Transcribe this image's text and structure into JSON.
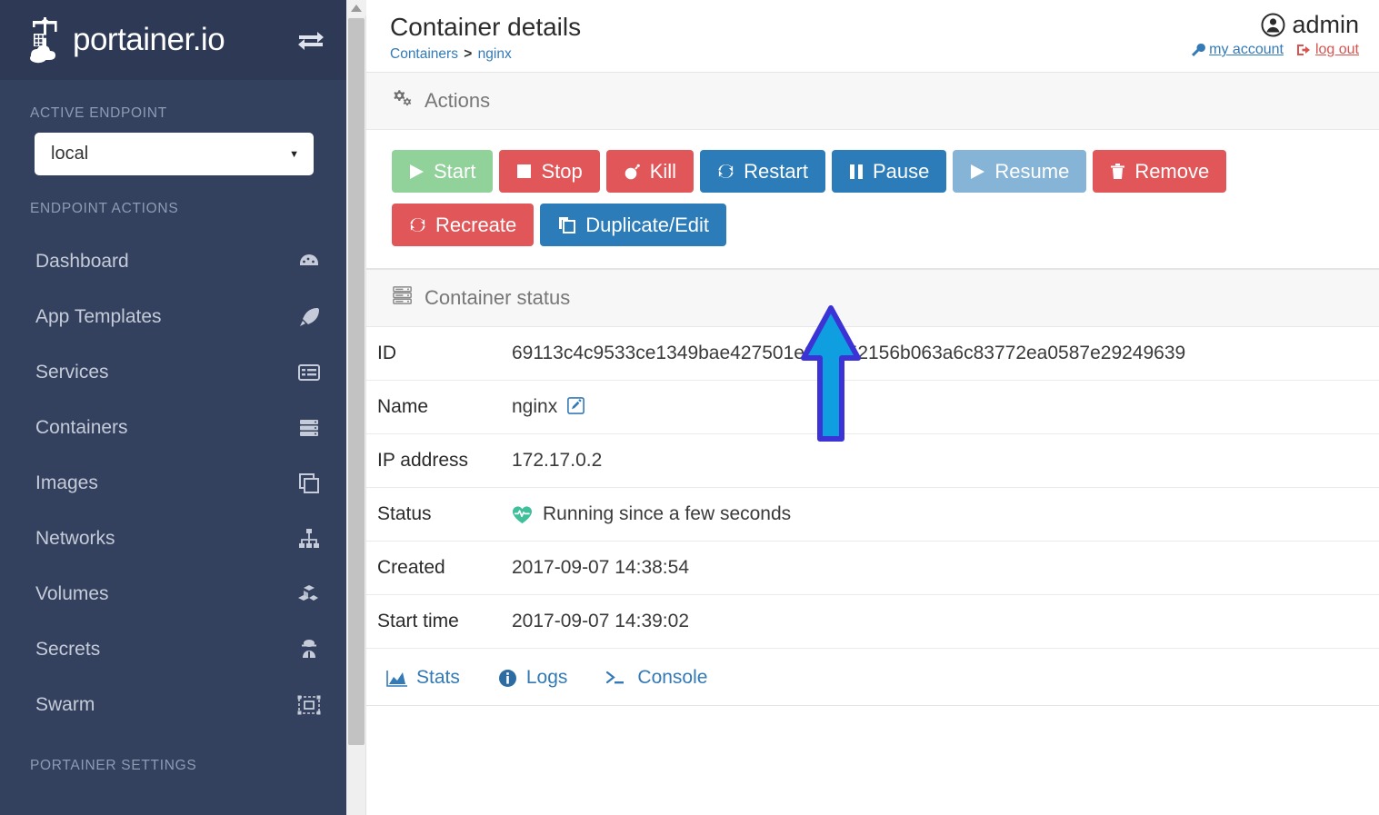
{
  "sidebar": {
    "brand": "portainer.io",
    "toggle_icon": "exchange-arrows-icon",
    "sections": {
      "active_endpoint": "ACTIVE ENDPOINT",
      "endpoint_actions": "ENDPOINT ACTIONS",
      "portainer_settings": "PORTAINER SETTINGS"
    },
    "endpoint_selected": "local",
    "items": [
      {
        "label": "Dashboard",
        "icon": "tachometer-icon"
      },
      {
        "label": "App Templates",
        "icon": "rocket-icon"
      },
      {
        "label": "Services",
        "icon": "list-alt-icon"
      },
      {
        "label": "Containers",
        "icon": "server-icon"
      },
      {
        "label": "Images",
        "icon": "clone-icon"
      },
      {
        "label": "Networks",
        "icon": "sitemap-icon"
      },
      {
        "label": "Volumes",
        "icon": "cubes-icon"
      },
      {
        "label": "Secrets",
        "icon": "user-secret-icon"
      },
      {
        "label": "Swarm",
        "icon": "object-group-icon"
      }
    ]
  },
  "header": {
    "title": "Container details",
    "breadcrumb_root": "Containers",
    "breadcrumb_sep": ">",
    "breadcrumb_current": "nginx",
    "user_name": "admin",
    "my_account": "my account",
    "log_out": "log out"
  },
  "actions_panel": {
    "title": "Actions",
    "icon": "gears-icon",
    "buttons": [
      {
        "label": "Start",
        "style": "success",
        "icon": "play-icon"
      },
      {
        "label": "Stop",
        "style": "danger",
        "icon": "stop-icon"
      },
      {
        "label": "Kill",
        "style": "danger",
        "icon": "bomb-icon"
      },
      {
        "label": "Restart",
        "style": "primary",
        "icon": "refresh-icon"
      },
      {
        "label": "Pause",
        "style": "primary",
        "icon": "pause-icon"
      },
      {
        "label": "Resume",
        "style": "info",
        "icon": "play-icon"
      },
      {
        "label": "Remove",
        "style": "danger",
        "icon": "trash-icon"
      },
      {
        "label": "Recreate",
        "style": "danger",
        "icon": "refresh-icon"
      },
      {
        "label": "Duplicate/Edit",
        "style": "primary",
        "icon": "copy-icon"
      }
    ]
  },
  "status_panel": {
    "title": "Container status",
    "icon": "server-icon",
    "rows": [
      {
        "key": "ID",
        "value": "69113c4c9533ce1349bae427501e860952156b063a6c83772ea0587e29249639"
      },
      {
        "key": "Name",
        "value": "nginx"
      },
      {
        "key": "IP address",
        "value": "172.17.0.2"
      },
      {
        "key": "Status",
        "value": "Running since a few seconds"
      },
      {
        "key": "Created",
        "value": "2017-09-07 14:38:54"
      },
      {
        "key": "Start time",
        "value": "2017-09-07 14:39:02"
      }
    ],
    "links": [
      {
        "label": "Stats",
        "icon": "area-chart-icon"
      },
      {
        "label": "Logs",
        "icon": "info-circle-icon"
      },
      {
        "label": "Console",
        "icon": "terminal-icon"
      }
    ]
  },
  "annotation": {
    "type": "up-arrow",
    "points_at": "Recreate",
    "fill_color": "#0f9fe0",
    "outline_color": "#3b33d6"
  },
  "colors": {
    "sidebar_bg": "#33415e",
    "sidebar_header_bg": "#2e3a55",
    "accent_blue": "#337ab7",
    "danger_red": "#e15759",
    "success_green": "#91d19a",
    "status_green": "#3fbf9a"
  }
}
